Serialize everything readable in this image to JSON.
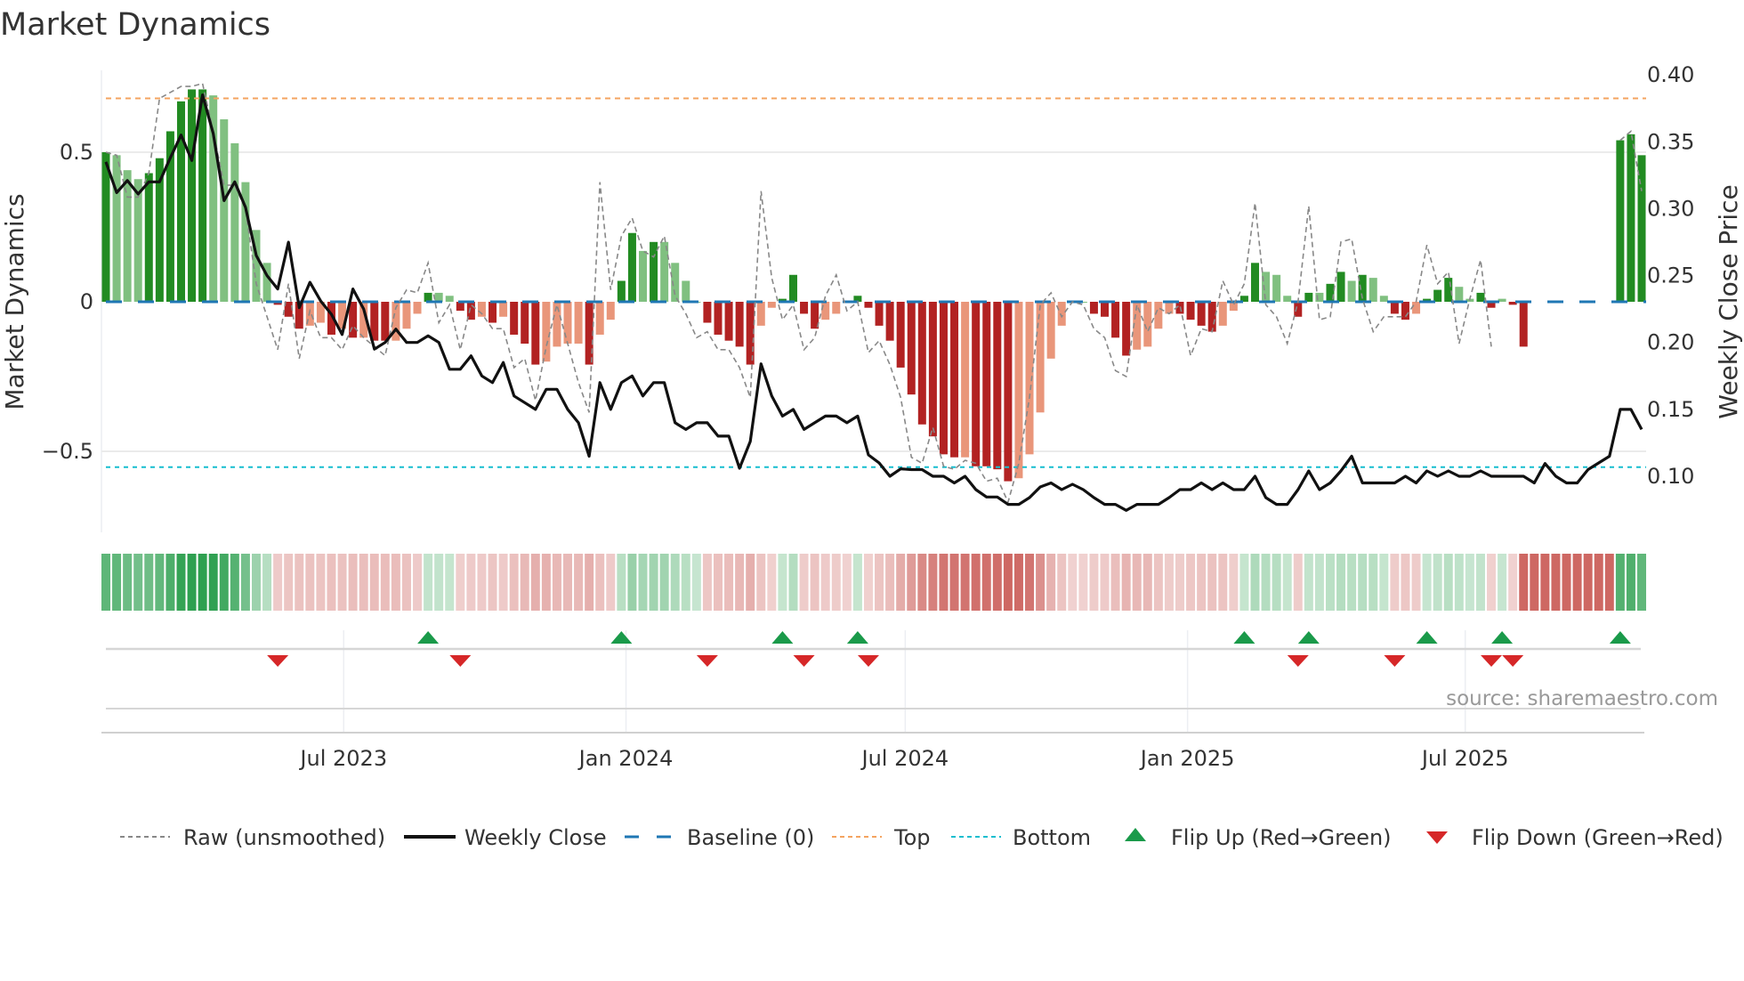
{
  "chart_data": {
    "type": "bar",
    "title": "Market Dynamics",
    "ylabel": "Market Dynamics",
    "ylabel_right": "Weekly Close Price",
    "start_date": "2023-01-27",
    "freq": "weekly",
    "ylim": [
      -0.8,
      0.78
    ],
    "ylim_right": [
      0.055,
      0.41
    ],
    "yticks": [
      {
        "value": 0.5,
        "label": "0.5"
      },
      {
        "value": 0,
        "label": "0"
      },
      {
        "value": -0.5,
        "label": "−0.5"
      }
    ],
    "yticks_right": [
      {
        "value": 0.4,
        "label": "0.40"
      },
      {
        "value": 0.35,
        "label": "0.35"
      },
      {
        "value": 0.3,
        "label": "0.30"
      },
      {
        "value": 0.25,
        "label": "0.25"
      },
      {
        "value": 0.2,
        "label": "0.20"
      },
      {
        "value": 0.15,
        "label": "0.15"
      },
      {
        "value": 0.1,
        "label": "0.10"
      }
    ],
    "xticks": [
      {
        "date": "2023-07-01",
        "label": "Jul 2023"
      },
      {
        "date": "2024-01-01",
        "label": "Jan 2024"
      },
      {
        "date": "2024-07-01",
        "label": "Jul 2024"
      },
      {
        "date": "2025-01-01",
        "label": "Jan 2025"
      },
      {
        "date": "2025-07-01",
        "label": "Jul 2025"
      }
    ],
    "grid": true,
    "top_level": 0.68,
    "bottom_level": -0.553,
    "baseline": 0,
    "colors": {
      "up_strong": "#228b22",
      "up_weak": "#80c080",
      "down_strong": "#b22222",
      "down_weak": "#e9967a",
      "raw": "#888888",
      "close": "#111111",
      "baseline": "#1f77b4",
      "top": "#f4a460",
      "bottom": "#17becf",
      "flip_up": "#1a9a4a",
      "flip_down": "#d62728"
    },
    "bars": [
      0.5,
      0.49,
      0.44,
      0.41,
      0.43,
      0.48,
      0.57,
      0.67,
      0.71,
      0.71,
      0.69,
      0.61,
      0.53,
      0.4,
      0.24,
      0.13,
      -0.01,
      -0.05,
      -0.09,
      -0.08,
      -0.07,
      -0.11,
      -0.09,
      -0.12,
      -0.12,
      -0.13,
      -0.13,
      -0.13,
      -0.09,
      -0.04,
      0.03,
      0.03,
      0.02,
      -0.03,
      -0.06,
      -0.05,
      -0.07,
      -0.05,
      -0.11,
      -0.14,
      -0.21,
      -0.2,
      -0.15,
      -0.14,
      -0.14,
      -0.21,
      -0.11,
      -0.06,
      0.07,
      0.23,
      0.17,
      0.2,
      0.2,
      0.13,
      0.07,
      0.0,
      -0.07,
      -0.11,
      -0.13,
      -0.15,
      -0.21,
      -0.08,
      -0.02,
      0.01,
      0.09,
      -0.04,
      -0.09,
      -0.06,
      -0.04,
      0.0,
      0.02,
      -0.02,
      -0.08,
      -0.13,
      -0.22,
      -0.31,
      -0.41,
      -0.45,
      -0.51,
      -0.52,
      -0.52,
      -0.55,
      -0.55,
      -0.56,
      -0.6,
      -0.59,
      -0.51,
      -0.37,
      -0.19,
      -0.08,
      0.0,
      0.0,
      -0.04,
      -0.05,
      -0.12,
      -0.18,
      -0.16,
      -0.15,
      -0.09,
      -0.04,
      -0.04,
      -0.06,
      -0.08,
      -0.1,
      -0.08,
      -0.03,
      0.02,
      0.13,
      0.1,
      0.09,
      0.02,
      -0.05,
      0.03,
      0.03,
      0.06,
      0.1,
      0.07,
      0.09,
      0.08,
      0.02,
      -0.04,
      -0.06,
      -0.04,
      0.01,
      0.04,
      0.08,
      0.05,
      0.01,
      0.03,
      -0.02,
      0.01,
      -0.01,
      -0.15,
      null,
      null,
      null,
      null,
      null,
      null,
      null,
      null,
      0.54,
      0.56,
      0.49
    ],
    "shade": [
      "d",
      "l",
      "l",
      "l",
      "d",
      "d",
      "d",
      "d",
      "d",
      "d",
      "l",
      "l",
      "l",
      "l",
      "l",
      "l",
      "d",
      "d",
      "d",
      "l",
      "l",
      "d",
      "l",
      "d",
      "l",
      "d",
      "d",
      "l",
      "l",
      "l",
      "d",
      "l",
      "l",
      "d",
      "d",
      "l",
      "d",
      "l",
      "d",
      "d",
      "d",
      "l",
      "l",
      "l",
      "l",
      "d",
      "l",
      "l",
      "d",
      "d",
      "l",
      "d",
      "l",
      "l",
      "l",
      "l",
      "d",
      "d",
      "d",
      "d",
      "d",
      "l",
      "l",
      "d",
      "d",
      "d",
      "d",
      "l",
      "l",
      "l",
      "d",
      "d",
      "d",
      "d",
      "d",
      "d",
      "d",
      "d",
      "d",
      "d",
      "l",
      "d",
      "d",
      "d",
      "d",
      "l",
      "l",
      "l",
      "l",
      "l",
      "l",
      "l",
      "d",
      "d",
      "d",
      "d",
      "l",
      "l",
      "l",
      "l",
      "d",
      "d",
      "d",
      "d",
      "l",
      "l",
      "d",
      "d",
      "l",
      "l",
      "l",
      "d",
      "d",
      "l",
      "d",
      "d",
      "l",
      "d",
      "l",
      "l",
      "d",
      "d",
      "l",
      "d",
      "d",
      "d",
      "l",
      "l",
      "d",
      "d",
      "l",
      "d",
      "d",
      "d",
      "d",
      "d",
      "d",
      "d",
      "d",
      "d",
      "d",
      "d",
      "d",
      "d",
      "l"
    ],
    "raw": [
      0.5,
      0.49,
      0.35,
      0.35,
      0.43,
      0.68,
      0.7,
      0.72,
      0.72,
      0.73,
      0.57,
      0.39,
      0.39,
      0.31,
      0.06,
      -0.05,
      -0.16,
      0.06,
      -0.19,
      -0.03,
      -0.12,
      -0.12,
      -0.16,
      -0.08,
      -0.12,
      -0.15,
      -0.18,
      -0.02,
      0.04,
      0.03,
      0.13,
      -0.07,
      -0.01,
      -0.16,
      -0.01,
      -0.04,
      -0.09,
      -0.09,
      -0.22,
      -0.19,
      -0.33,
      -0.15,
      -0.01,
      -0.14,
      -0.27,
      -0.37,
      0.4,
      0.04,
      0.22,
      0.28,
      0.17,
      0.15,
      0.22,
      0.02,
      -0.04,
      -0.12,
      -0.1,
      -0.16,
      -0.16,
      -0.22,
      -0.32,
      0.37,
      0.08,
      -0.06,
      -0.01,
      -0.16,
      -0.12,
      0.02,
      0.09,
      -0.03,
      0.0,
      -0.17,
      -0.13,
      -0.21,
      -0.32,
      -0.52,
      -0.54,
      -0.42,
      -0.55,
      -0.56,
      -0.53,
      -0.54,
      -0.6,
      -0.59,
      -0.67,
      -0.54,
      -0.32,
      -0.01,
      0.03,
      -0.05,
      0.0,
      -0.01,
      -0.09,
      -0.12,
      -0.23,
      -0.25,
      -0.01,
      -0.1,
      -0.02,
      -0.04,
      -0.01,
      -0.18,
      -0.09,
      -0.1,
      0.07,
      -0.01,
      0.06,
      0.33,
      -0.01,
      -0.05,
      -0.14,
      0.0,
      0.32,
      -0.06,
      -0.05,
      0.2,
      0.21,
      0.01,
      -0.1,
      -0.05,
      -0.05,
      -0.05,
      0.0,
      0.19,
      0.06,
      0.1,
      -0.14,
      0.01,
      0.14,
      -0.15,
      null,
      null,
      null,
      null,
      null,
      null,
      null,
      null,
      null,
      null,
      null,
      0.54,
      0.57,
      0.37
    ],
    "price": [
      0.335,
      0.312,
      0.321,
      0.311,
      0.32,
      0.32,
      0.338,
      0.355,
      0.336,
      0.385,
      0.356,
      0.306,
      0.32,
      0.301,
      0.265,
      0.25,
      0.24,
      0.275,
      0.226,
      0.245,
      0.231,
      0.221,
      0.206,
      0.24,
      0.225,
      0.195,
      0.2,
      0.21,
      0.2,
      0.2,
      0.205,
      0.2,
      0.18,
      0.18,
      0.19,
      0.175,
      0.17,
      0.185,
      0.16,
      0.155,
      0.15,
      0.165,
      0.165,
      0.15,
      0.14,
      0.115,
      0.17,
      0.15,
      0.17,
      0.175,
      0.16,
      0.17,
      0.17,
      0.14,
      0.135,
      0.14,
      0.14,
      0.13,
      0.13,
      0.106,
      0.126,
      0.184,
      0.16,
      0.145,
      0.15,
      0.135,
      0.14,
      0.145,
      0.145,
      0.14,
      0.145,
      0.116,
      0.11,
      0.1,
      0.1055,
      0.105,
      0.105,
      0.1,
      0.1,
      0.095,
      0.1,
      0.09,
      0.0845,
      0.0845,
      0.079,
      0.079,
      0.084,
      0.092,
      0.095,
      0.09,
      0.094,
      0.09,
      0.084,
      0.079,
      0.079,
      0.0745,
      0.079,
      0.079,
      0.079,
      0.084,
      0.09,
      0.09,
      0.095,
      0.09,
      0.095,
      0.09,
      0.09,
      0.1,
      0.084,
      0.079,
      0.079,
      0.09,
      0.104,
      0.09,
      0.095,
      0.104,
      0.115,
      0.095,
      0.095,
      0.095,
      0.095,
      0.1,
      0.095,
      0.104,
      0.1,
      0.104,
      0.1,
      0.1,
      0.104,
      0.1,
      0.1,
      0.1,
      0.1,
      0.095,
      0.1095,
      0.1,
      0.095,
      0.095,
      0.105,
      0.11,
      0.115,
      0.15,
      0.15,
      0.135
    ],
    "regime": [
      0.5,
      0.49,
      0.44,
      0.41,
      0.43,
      0.48,
      0.57,
      0.67,
      0.71,
      0.71,
      0.69,
      0.61,
      0.53,
      0.4,
      0.24,
      0.13,
      -0.1,
      -0.12,
      -0.14,
      -0.14,
      -0.13,
      -0.15,
      -0.14,
      -0.16,
      -0.16,
      -0.17,
      -0.17,
      -0.17,
      -0.14,
      -0.1,
      0.08,
      0.08,
      0.07,
      -0.08,
      -0.1,
      -0.1,
      -0.12,
      -0.1,
      -0.15,
      -0.18,
      -0.24,
      -0.23,
      -0.19,
      -0.18,
      -0.18,
      -0.24,
      -0.15,
      -0.1,
      0.12,
      0.25,
      0.2,
      0.22,
      0.22,
      0.17,
      0.12,
      0.06,
      -0.11,
      -0.15,
      -0.17,
      -0.19,
      -0.24,
      -0.13,
      -0.07,
      0.07,
      0.14,
      -0.09,
      -0.13,
      -0.1,
      -0.09,
      -0.06,
      0.07,
      -0.07,
      -0.13,
      -0.17,
      -0.25,
      -0.34,
      -0.43,
      -0.47,
      -0.53,
      -0.54,
      -0.54,
      -0.56,
      -0.56,
      -0.57,
      -0.6,
      -0.59,
      -0.53,
      -0.39,
      -0.22,
      -0.13,
      -0.06,
      -0.06,
      -0.09,
      -0.1,
      -0.16,
      -0.21,
      -0.19,
      -0.19,
      -0.13,
      -0.09,
      -0.09,
      -0.11,
      -0.13,
      -0.14,
      -0.13,
      -0.08,
      0.07,
      0.17,
      0.14,
      0.13,
      0.07,
      -0.09,
      0.08,
      0.08,
      0.11,
      0.14,
      0.12,
      0.13,
      0.12,
      0.07,
      -0.09,
      -0.11,
      -0.09,
      0.06,
      0.09,
      0.12,
      0.1,
      0.06,
      0.08,
      -0.07,
      0.06,
      -0.06,
      -0.6,
      -0.6,
      -0.6,
      -0.6,
      -0.6,
      -0.6,
      -0.6,
      -0.6,
      -0.6,
      0.54,
      0.56,
      0.49
    ],
    "flips_up": [
      30,
      48,
      63,
      70,
      106,
      112,
      123,
      130,
      141
    ],
    "flips_down": [
      16,
      33,
      56,
      65,
      71,
      111,
      120,
      129,
      131
    ],
    "legend": {
      "placement": "bottom",
      "items": [
        {
          "key": "raw",
          "label": "Raw (unsmoothed)"
        },
        {
          "key": "close",
          "label": "Weekly Close"
        },
        {
          "key": "baseline",
          "label": "Baseline (0)"
        },
        {
          "key": "top",
          "label": "Top"
        },
        {
          "key": "bottom",
          "label": "Bottom"
        },
        {
          "key": "flip_up",
          "label": "Flip Up (Red→Green)"
        },
        {
          "key": "flip_down",
          "label": "Flip Down (Green→Red)"
        }
      ]
    },
    "source": "source: sharemaestro.com"
  }
}
